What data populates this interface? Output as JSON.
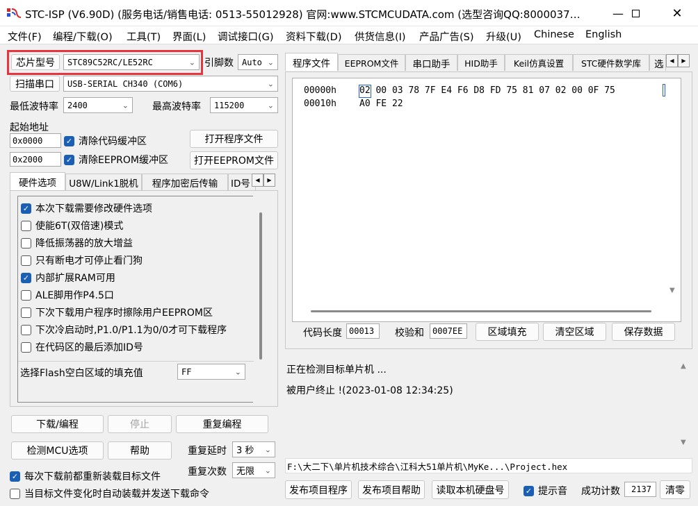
{
  "window": {
    "title": "STC-ISP (V6.90D) (服务电话/销售电话: 0513-55012928) 官网:www.STCMCUDATA.com (选型咨询QQ:8000037…"
  },
  "menu": [
    "文件(F)",
    "编程/下载(O)",
    "工具(T)",
    "界面(L)",
    "调试接口(G)",
    "资料下载(D)",
    "供货信息(I)",
    "产品广告(S)",
    "升级(U)",
    "Chinese",
    "English"
  ],
  "chip": {
    "label": "芯片型号",
    "value": "STC89C52RC/LE52RC",
    "pins_label": "引脚数",
    "pins_value": "Auto"
  },
  "port": {
    "button": "扫描串口",
    "value": "USB-SERIAL CH340 (COM6)"
  },
  "baud": {
    "min_label": "最低波特率",
    "min_value": "2400",
    "max_label": "最高波特率",
    "max_value": "115200"
  },
  "address": {
    "label": "起始地址",
    "code_addr": "0x0000",
    "eeprom_addr": "0x2000",
    "clear_code": "清除代码缓冲区",
    "clear_eeprom": "清除EEPROM缓冲区",
    "open_prog": "打开程序文件",
    "open_eeprom": "打开EEPROM文件"
  },
  "left_tabs": [
    "硬件选项",
    "U8W/Link1脱机",
    "程序加密后传输",
    "ID号"
  ],
  "options": [
    {
      "label": "本次下载需要修改硬件选项",
      "checked": true
    },
    {
      "label": "使能6T(双倍速)模式",
      "checked": false
    },
    {
      "label": "降低振荡器的放大增益",
      "checked": false
    },
    {
      "label": "只有断电才可停止看门狗",
      "checked": false
    },
    {
      "label": "内部扩展RAM可用",
      "checked": true
    },
    {
      "label": "ALE脚用作P4.5口",
      "checked": false
    },
    {
      "label": "下次下载用户程序时擦除用户EEPROM区",
      "checked": false
    },
    {
      "label": "下次冷启动时,P1.0/P1.1为0/0才可下载程序",
      "checked": false
    },
    {
      "label": "在代码区的最后添加ID号",
      "checked": false
    }
  ],
  "fill": {
    "label": "选择Flash空白区域的填充值",
    "value": "FF"
  },
  "actions": {
    "download": "下载/编程",
    "stop": "停止",
    "reprogram": "重复编程",
    "check_mcu": "检测MCU选项",
    "help": "帮助",
    "delay_label": "重复延时",
    "delay_value": "3 秒",
    "count_label": "重复次数",
    "count_value": "无限",
    "reload_each": "每次下载前都重新装载目标文件",
    "auto_reload": "当目标文件变化时自动装载并发送下载命令"
  },
  "right_tabs": [
    "程序文件",
    "EEPROM文件",
    "串口助手",
    "HID助手",
    "Keil仿真设置",
    "STC硬件数学库",
    "选"
  ],
  "hex": [
    {
      "addr": "00000h",
      "bytes": "02 00 03 78 7F E4 F6 D8 FD 75 81 07 02 00 0F 75"
    },
    {
      "addr": "00010h",
      "bytes": "A0 FE 22"
    }
  ],
  "code_info": {
    "len_label": "代码长度",
    "len_value": "00013",
    "sum_label": "校验和",
    "sum_value": "0007EE",
    "fill_btn": "区域填充",
    "clear_btn": "清空区域",
    "save_btn": "保存数据"
  },
  "log": [
    "正在检测目标单片机 ...",
    "被用户终止 !(2023-01-08 12:34:25)"
  ],
  "file_path": "F:\\大二下\\单片机技术综合\\江科大51单片机\\MyKe...\\Project.hex",
  "bottom": {
    "publish_prog": "发布项目程序",
    "publish_help": "发布项目帮助",
    "read_disk": "读取本机硬盘号",
    "beep": "提示音",
    "success_label": "成功计数",
    "success_value": "2137",
    "clear": "清零"
  },
  "colors": {
    "highlight_box": "#e8343c",
    "accent": "#1a5fb4"
  }
}
